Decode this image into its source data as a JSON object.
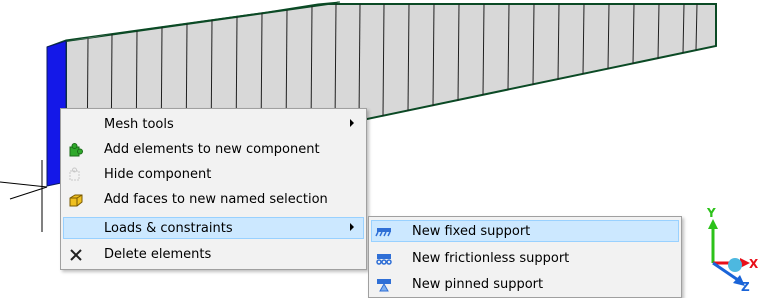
{
  "context_menu": {
    "items": [
      {
        "label": "Mesh tools",
        "icon": "none",
        "submenu": true
      },
      {
        "label": "Add elements to new component",
        "icon": "puzzle-piece-icon"
      },
      {
        "label": "Hide component",
        "icon": "hide-component-icon",
        "disabled_look": true
      },
      {
        "label": "Add faces to new named selection",
        "icon": "named-selection-cube-icon"
      },
      {
        "label": "Loads & constraints",
        "icon": "none",
        "submenu": true,
        "selected": true
      },
      {
        "label": "Delete elements",
        "icon": "delete-x-icon"
      }
    ]
  },
  "submenu": {
    "items": [
      {
        "label": "New fixed support",
        "icon": "fixed-support-icon",
        "selected": true
      },
      {
        "label": "New frictionless support",
        "icon": "frictionless-support-icon"
      },
      {
        "label": "New pinned support",
        "icon": "pinned-support-icon"
      }
    ]
  },
  "triad": {
    "x_label": "X",
    "y_label": "Y",
    "z_label": "Z",
    "x_color": "#e8101a",
    "y_color": "#2cc21a",
    "z_color": "#1a64d8"
  },
  "colors": {
    "mesh_fill": "#d8d8d8",
    "mesh_lines": "#1f1f1f",
    "mesh_edge": "#0b4a25",
    "selected_face": "#1418e8",
    "menu_highlight": "#cce8ff"
  }
}
